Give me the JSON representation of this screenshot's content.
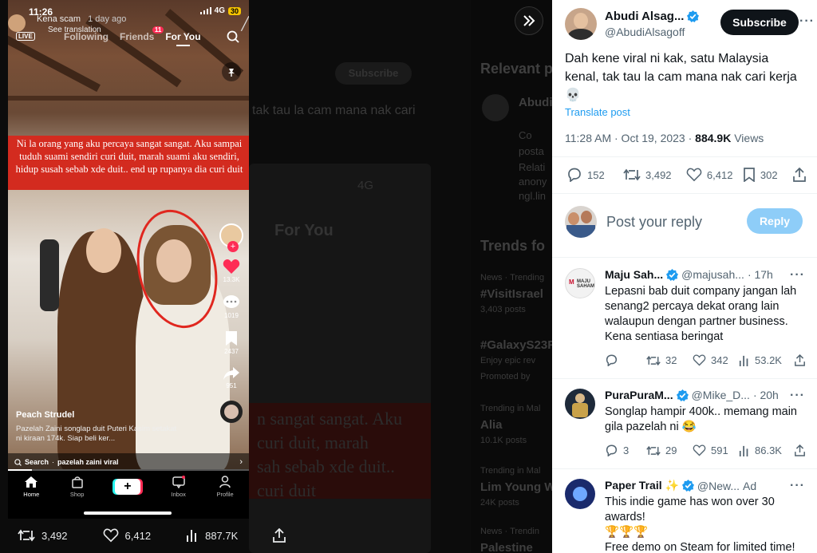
{
  "background": {
    "bg_subscribe_label": "Subscribe",
    "bg_tweet_fragment": "tak tau la cam mana nak cari",
    "relevant_label": "Relevant p",
    "trends_label": "Trends fo",
    "trends": [
      {
        "meta": "News · Trending",
        "name": "#VisitIsrael",
        "count": "3,403 posts"
      },
      {
        "meta": "",
        "name": "#GalaxyS23F",
        "count": "Enjoy epic rev"
      },
      {
        "meta": "",
        "name": "",
        "count": "Promoted by"
      },
      {
        "meta": "Trending in Mal",
        "name": "Alia",
        "count": "10.1K posts"
      },
      {
        "meta": "Trending in Mal",
        "name": "Lim Young Wo",
        "count": "24K posts"
      },
      {
        "meta": "News · Trendin",
        "name": "Palestine",
        "count": ""
      }
    ],
    "relevant_name": "Abudi",
    "relevant_lines": [
      "Co",
      "posta",
      "Relati",
      "anony",
      "ngl.lin"
    ],
    "bg_caption_lines": [
      "n sangat sangat. Aku",
      "curi duit, marah",
      "sah sebab xde duit..",
      "curi duit"
    ],
    "bg_phone_tab": "For You",
    "stats": {
      "retweets": "3,492",
      "likes": "6,412",
      "views": "887.7K"
    }
  },
  "tiktok": {
    "status_time": "11:26",
    "network": "4G",
    "battery": "30",
    "live_label": "LIVE",
    "poster_name": "Kena scam",
    "posted_ago": "1 day ago",
    "see_translation": "See translation",
    "tabs": [
      "Following",
      "Friends",
      "For You"
    ],
    "friends_badge": "11",
    "caption": "Ni la orang yang aku percaya sangat sangat. Aku sampai tuduh suami sendiri curi duit, marah suami aku sendiri, hidup susah sebab xde duit.. end up rupanya dia curi duit",
    "likes": "13.3K",
    "comments": "1019",
    "saves": "2437",
    "shares": "951",
    "video_user": "Peach Strudel",
    "video_desc": "Pazelah Zaini songlap duit Puteri Kasim setakat ni kiraan 174k. Siap beli ker...",
    "search_label": "Search",
    "search_query": "pazelah zaini viral",
    "progress": 0.1,
    "nav": [
      "Home",
      "Shop",
      "",
      "Inbox",
      "Profile"
    ]
  },
  "tweet": {
    "name": "Abudi Alsag...",
    "handle": "@AbudiAlsagoff",
    "subscribe_label": "Subscribe",
    "text": "Dah kene viral ni kak, satu Malaysia kenal, tak tau la cam mana nak cari kerja 💀",
    "translate_label": "Translate post",
    "timestamp": "11:28 AM · Oct 19, 2023 · ",
    "views_count": "884.9K",
    "views_label": " Views",
    "replies": "152",
    "retweets": "3,492",
    "likes": "6,412",
    "bookmarks": "302",
    "reply_placeholder": "Post your reply",
    "reply_button": "Reply"
  },
  "replies": [
    {
      "name": "Maju Sah...",
      "handle": "@majusah...",
      "time": "· 17h",
      "text": "Lepasni bab duit company jangan lah senang2 percaya dekat orang lain walaupun dengan partner business. Kena sentiasa beringat",
      "replies": "",
      "retweets": "32",
      "likes": "342",
      "views": "53.2K"
    },
    {
      "name": "PuraPuraM...",
      "handle": "@Mike_D...",
      "time": "· 20h",
      "text": "Songlap hampir 400k.. memang main gila pazelah ni 😂",
      "replies": "3",
      "retweets": "29",
      "likes": "591",
      "views": "86.3K"
    },
    {
      "name": "Paper Trail ✨",
      "handle": "@New...",
      "time": "Ad",
      "text": "This indie game has won over 30 awards!\n🏆🏆🏆\nFree demo on Steam for limited time!",
      "replies": "",
      "retweets": "",
      "likes": "",
      "views": ""
    }
  ],
  "colors": {
    "accent": "#1d9bf0",
    "tiktok_red": "#fe2c55",
    "caption_red": "#d32b1f",
    "verified": "#1d9bf0"
  }
}
